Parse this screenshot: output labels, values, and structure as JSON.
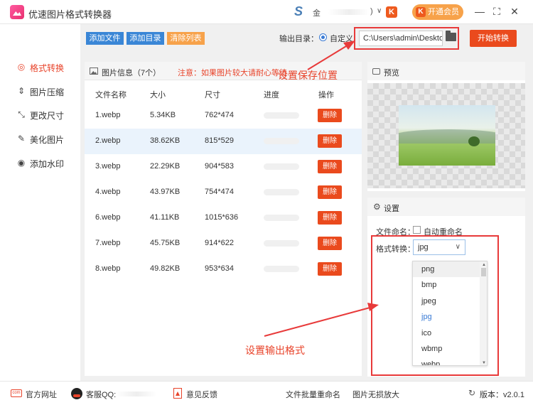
{
  "app": {
    "title": "优速图片格式转换器",
    "user_name": "金",
    "user_suffix": ")",
    "vip_label": "开通会员",
    "k_glyph": "K"
  },
  "sidebar": {
    "items": [
      {
        "label": "格式转换",
        "icon": "refresh-circle-icon",
        "active": true
      },
      {
        "label": "图片压缩",
        "icon": "compress-icon",
        "active": false
      },
      {
        "label": "更改尺寸",
        "icon": "resize-icon",
        "active": false
      },
      {
        "label": "美化图片",
        "icon": "beautify-icon",
        "active": false
      },
      {
        "label": "添加水印",
        "icon": "watermark-icon",
        "active": false
      }
    ]
  },
  "toolbar": {
    "add_file": "添加文件",
    "add_folder": "添加目录",
    "clear_list": "清除列表",
    "output_label": "输出目录：",
    "custom_label": "自定义",
    "output_path": "C:\\Users\\admin\\Deskto",
    "start_label": "开始转换"
  },
  "file_panel": {
    "title": "图片信息（7个）",
    "warning": "注意：如果图片较大请耐心等待...",
    "columns": [
      "文件名称",
      "大小",
      "尺寸",
      "进度",
      "操作"
    ],
    "delete_label": "删除",
    "rows": [
      {
        "name": "1.webp",
        "size": "5.34KB",
        "dims": "762*474",
        "progress": 0
      },
      {
        "name": "2.webp",
        "size": "38.62KB",
        "dims": "815*529",
        "progress": 0
      },
      {
        "name": "3.webp",
        "size": "22.29KB",
        "dims": "904*583",
        "progress": 0
      },
      {
        "name": "4.webp",
        "size": "43.97KB",
        "dims": "754*474",
        "progress": 0
      },
      {
        "name": "6.webp",
        "size": "41.11KB",
        "dims": "1015*636",
        "progress": 0
      },
      {
        "name": "7.webp",
        "size": "45.75KB",
        "dims": "914*622",
        "progress": 0
      },
      {
        "name": "8.webp",
        "size": "49.82KB",
        "dims": "953*634",
        "progress": 0
      }
    ]
  },
  "preview": {
    "title": "预览"
  },
  "settings": {
    "title": "设置",
    "filename_label": "文件命名：",
    "auto_rename": "自动重命名",
    "format_label": "格式转换：",
    "selected_format": "jpg",
    "options": [
      "png",
      "bmp",
      "jpeg",
      "jpg",
      "ico",
      "wbmp",
      "webp"
    ]
  },
  "annotations": {
    "save_location": "设置保存位置",
    "output_format": "设置输出格式"
  },
  "footer": {
    "website": "官方网址",
    "qq": "客服QQ:",
    "feedback": "意见反馈",
    "batch_rename": "文件批量重命名",
    "lossless_zoom": "图片无损放大",
    "version": "版本：v2.0.1",
    "web_icon_text": "com"
  },
  "colors": {
    "accent": "#ea4a1d",
    "blue_btn": "#3a86d6",
    "orange_btn": "#f7a24a",
    "annotation": "#e83a3a"
  }
}
